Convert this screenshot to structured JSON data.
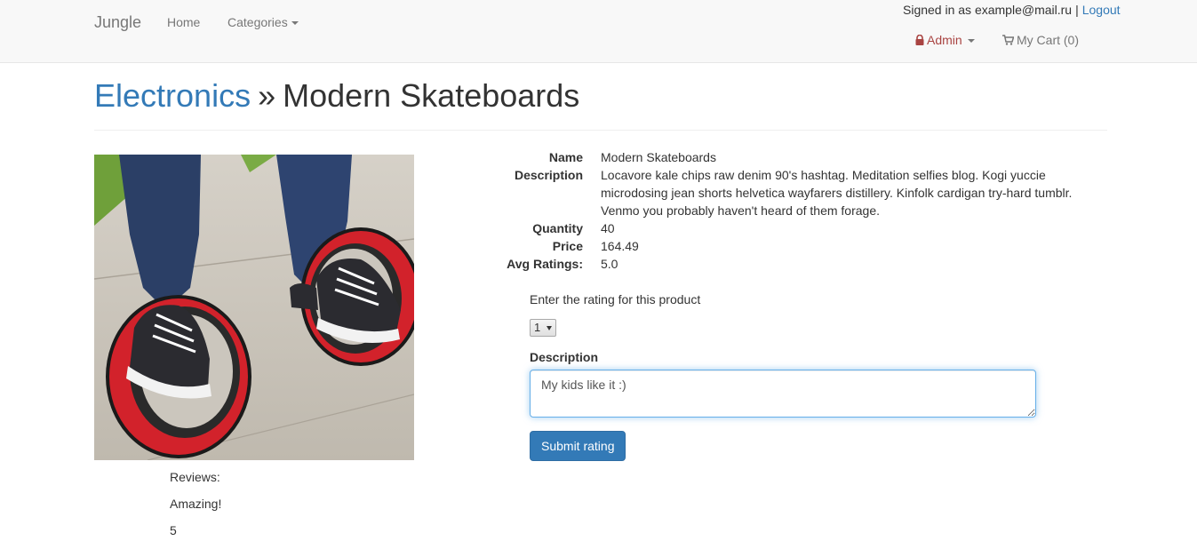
{
  "navbar": {
    "brand": "Jungle",
    "home_label": "Home",
    "categories_label": "Categories",
    "signed_in_text": "Signed in as example@mail.ru",
    "separator": "|",
    "logout_label": "Logout",
    "admin_label": "Admin",
    "cart_label": "My Cart (0)"
  },
  "header": {
    "category_link": "Electronics",
    "separator": "»",
    "product_title": "Modern Skateboards"
  },
  "product": {
    "image_alt": "Modern Skateboards",
    "details": [
      {
        "label": "Name",
        "value": "Modern Skateboards"
      },
      {
        "label": "Description",
        "value": "Locavore kale chips raw denim 90's hashtag. Meditation selfies blog. Kogi yuccie microdosing jean shorts helvetica wayfarers distillery. Kinfolk cardigan try-hard tumblr. Venmo you probably haven't heard of them forage."
      },
      {
        "label": "Quantity",
        "value": "40"
      },
      {
        "label": "Price",
        "value": "164.49"
      },
      {
        "label": "Avg Ratings:",
        "value": "5.0"
      }
    ]
  },
  "rating_form": {
    "prompt": "Enter the rating for this product",
    "selected_rating": "1",
    "description_label": "Description",
    "description_value": "My kids like it :)",
    "submit_label": "Submit rating"
  },
  "reviews": {
    "heading": "Reviews:",
    "items": [
      {
        "text": "Amazing!",
        "rating": "5"
      }
    ]
  },
  "colors": {
    "link": "#337ab7",
    "admin": "#a94442",
    "primary_button": "#337ab7",
    "navbar_bg": "#f8f8f8"
  }
}
